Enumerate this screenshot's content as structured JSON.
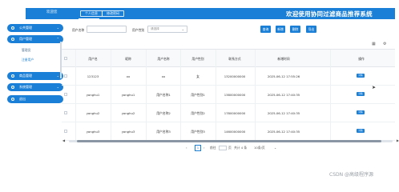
{
  "header": {
    "sys_label": "欢迎您",
    "tab_profile": "个人信息",
    "tab_password": "修改密码",
    "app_title": "欢迎使用协同过滤商品推荐系统"
  },
  "sidebar": {
    "items": [
      {
        "label": "公共管理"
      },
      {
        "label": "用户管理"
      },
      {
        "label": "商品管理"
      },
      {
        "label": "系统管理"
      },
      {
        "label": "退出"
      }
    ],
    "sub_items": [
      {
        "label": "管理员"
      },
      {
        "label": "注册用户"
      }
    ]
  },
  "search": {
    "account_label": "用户名称",
    "account_value": "",
    "gender_label": "用户性别",
    "gender_placeholder": "请选择",
    "buttons": [
      "查询",
      "新增",
      "删除",
      "导出"
    ]
  },
  "table": {
    "columns": [
      "用户名",
      "昵称",
      "用户名称",
      "用户性别",
      "联系方式",
      "新增时间",
      "操作"
    ],
    "rows": [
      {
        "c1": "123123",
        "c2": "xx",
        "c3": "xx",
        "c4": "女",
        "c5": "13200000000",
        "c6": "2025-06-12 17:55:26",
        "op": "详情"
      },
      {
        "c1": "yonghu1",
        "c2": "yonghu1",
        "c3": "用户名称1",
        "c4": "用户性别1",
        "c5": "13800000000",
        "c6": "2025-06-12 17:40:35",
        "op": "详情"
      },
      {
        "c1": "yonghu2",
        "c2": "yonghu2",
        "c3": "用户名称2",
        "c4": "用户性别2",
        "c5": "17800000000",
        "c6": "2025-06-12 17:40:35",
        "op": "详情"
      },
      {
        "c1": "yonghu3",
        "c2": "yonghu3",
        "c3": "用户名称3",
        "c4": "用户性别3",
        "c5": "14600000000",
        "c6": "2025-06-12 17:40:35",
        "op": "详情"
      }
    ]
  },
  "pager": {
    "current": "1",
    "goto_label": "前往",
    "page_suffix": "页",
    "total": "共计 4 条",
    "page_size": "10条/页"
  },
  "watermark": "CSDN @高级程序源"
}
